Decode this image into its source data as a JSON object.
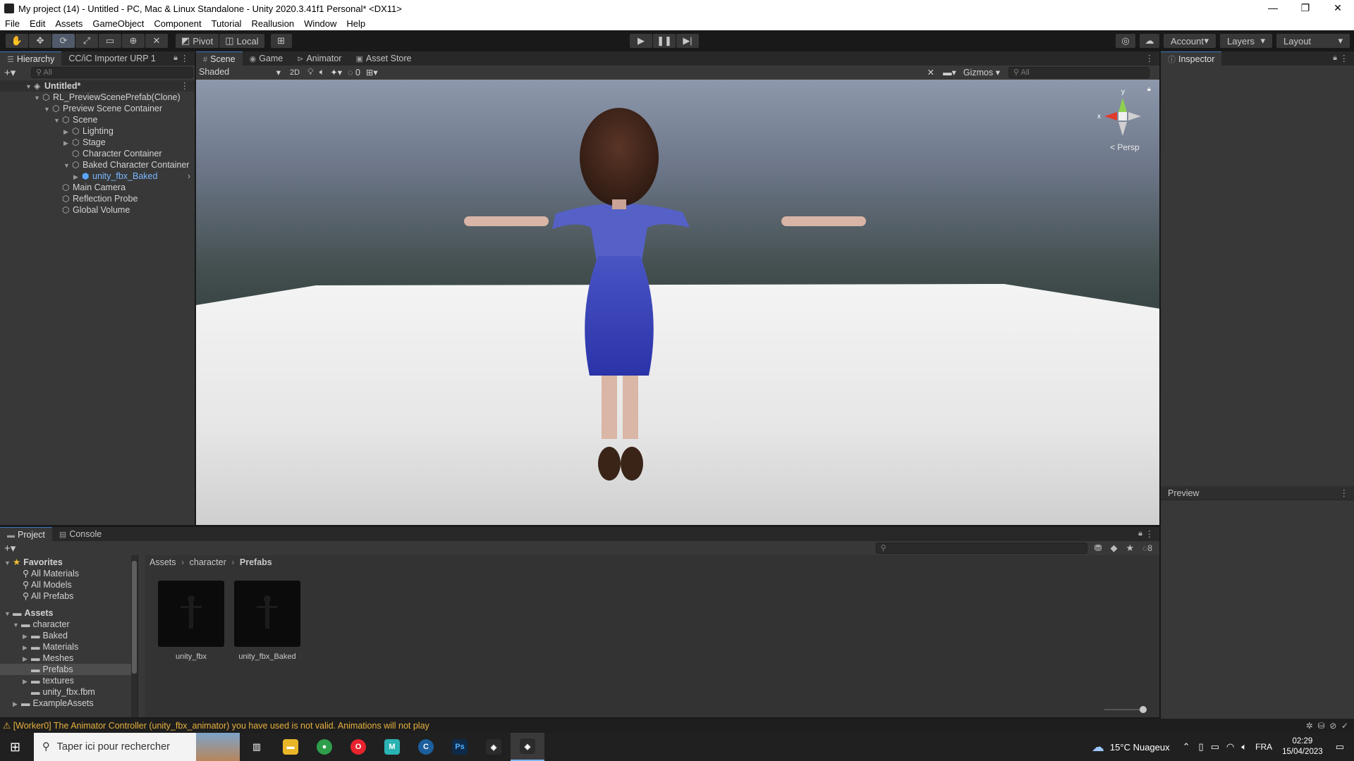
{
  "window": {
    "title": "My project (14) - Untitled - PC, Mac & Linux Standalone - Unity 2020.3.41f1 Personal* <DX11>",
    "controls": [
      "—",
      "❐",
      "✕"
    ]
  },
  "menu": [
    "File",
    "Edit",
    "Assets",
    "GameObject",
    "Component",
    "Tutorial",
    "Reallusion",
    "Window",
    "Help"
  ],
  "toolbar": {
    "pivot_label": "Pivot",
    "local_label": "Local",
    "account_label": "Account",
    "layers_label": "Layers",
    "layout_label": "Layout"
  },
  "hierarchy": {
    "tabs": [
      "Hierarchy",
      "CC/iC Importer URP 1"
    ],
    "search_placeholder": "All",
    "items": [
      {
        "label": "Untitled*"
      },
      {
        "label": "RL_PreviewScenePrefab(Clone)"
      },
      {
        "label": "Preview Scene Container"
      },
      {
        "label": "Scene"
      },
      {
        "label": "Lighting"
      },
      {
        "label": "Stage"
      },
      {
        "label": "Character Container"
      },
      {
        "label": "Baked Character Container"
      },
      {
        "label": "unity_fbx_Baked"
      },
      {
        "label": "Main Camera"
      },
      {
        "label": "Reflection Probe"
      },
      {
        "label": "Global Volume"
      }
    ]
  },
  "scene": {
    "tabs": [
      "Scene",
      "Game",
      "Animator",
      "Asset Store"
    ],
    "shading_mode": "Shaded",
    "mode_2d": "2D",
    "hidden_count": "0",
    "gizmos_label": "Gizmos",
    "search_placeholder": "All",
    "axis_y": "y",
    "axis_x": "x",
    "persp_label": "< Persp"
  },
  "inspector": {
    "tab": "Inspector",
    "preview_tab": "Preview"
  },
  "project": {
    "tabs": [
      "Project",
      "Console"
    ],
    "hidden_count": "8",
    "favorites_label": "Favorites",
    "favorites": [
      "All Materials",
      "All Models",
      "All Prefabs"
    ],
    "assets_label": "Assets",
    "folders": [
      {
        "label": "character"
      },
      {
        "label": "Baked"
      },
      {
        "label": "Materials"
      },
      {
        "label": "Meshes"
      },
      {
        "label": "Prefabs"
      },
      {
        "label": "textures"
      },
      {
        "label": "unity_fbx.fbm"
      },
      {
        "label": "ExampleAssets"
      }
    ],
    "breadcrumb": [
      "Assets",
      "character",
      "Prefabs"
    ],
    "assets": [
      "unity_fbx",
      "unity_fbx_Baked"
    ]
  },
  "status": {
    "message": "[Worker0] The Animator Controller (unity_fbx_animator) you have used is not valid. Animations will not play"
  },
  "taskbar": {
    "search_placeholder": "Taper ici pour rechercher",
    "weather": "15°C  Nuageux",
    "language": "FRA",
    "time": "02:29",
    "date": "15/04/2023"
  },
  "colors": {
    "accent": "#3a79bb",
    "selected_item": "#7ab7ff",
    "warning": "#e6b13e"
  }
}
